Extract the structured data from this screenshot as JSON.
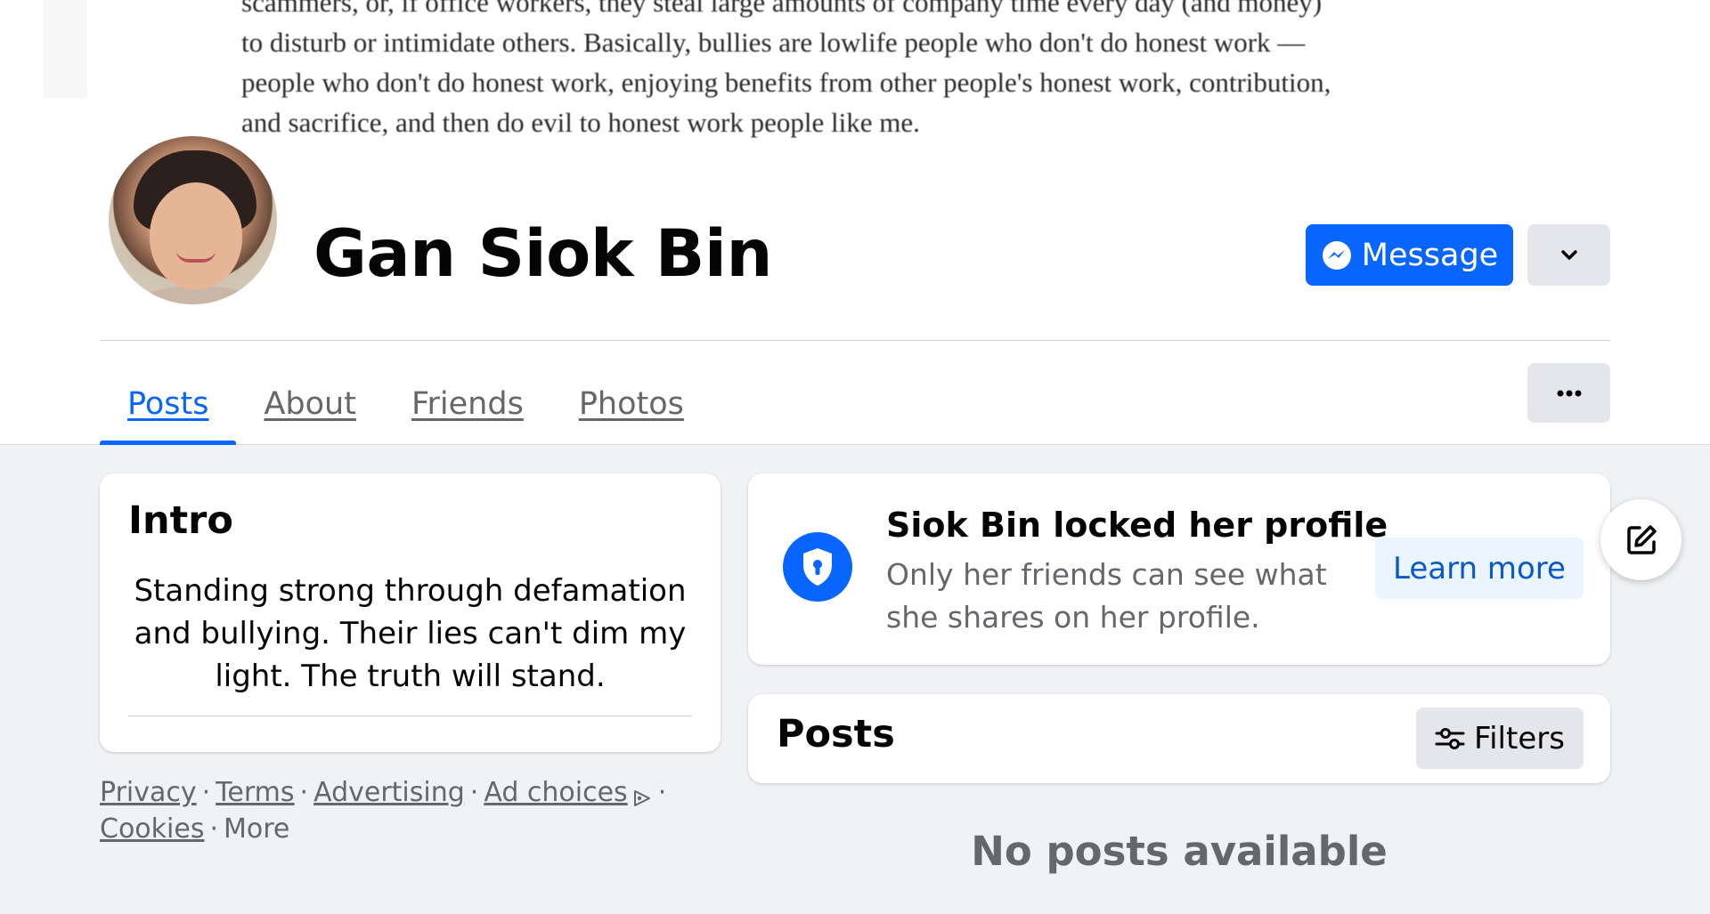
{
  "cover": {
    "lines": [
      "scammers, or, if office workers, they steal large amounts of company time every day (and money)",
      "to disturb or intimidate others. Basically, bullies are lowlife people who don't do honest work —",
      "people who don't do honest work, enjoying benefits from other people's honest work, contribution,",
      "and sacrifice, and then do evil to honest work people like me."
    ]
  },
  "profile": {
    "name": "Gan Siok Bin",
    "message_label": "Message"
  },
  "tabs": [
    {
      "label": "Posts",
      "active": true
    },
    {
      "label": "About",
      "active": false
    },
    {
      "label": "Friends",
      "active": false
    },
    {
      "label": "Photos",
      "active": false
    }
  ],
  "intro": {
    "title": "Intro",
    "bio": "Standing strong through defamation and bullying. Their lies can't dim my light. The truth will stand."
  },
  "footer": {
    "privacy": "Privacy",
    "terms": "Terms",
    "advertising": "Advertising",
    "ad_choices": "Ad choices",
    "cookies": "Cookies",
    "more": "More",
    "separator": "·"
  },
  "locked": {
    "title": "Siok Bin locked her profile",
    "description": "Only her friends can see what she shares on her profile.",
    "learn_more": "Learn more"
  },
  "posts": {
    "title": "Posts",
    "filters_label": "Filters",
    "empty_message": "No posts available"
  },
  "colors": {
    "accent": "#0866ff",
    "page_bg": "#f0f2f5",
    "secondary_text": "#65676b"
  },
  "icons": {
    "message": "messenger-icon",
    "more_actions": "chevron-down-icon",
    "tabs_more": "ellipsis-icon",
    "locked": "shield-keyhole-icon",
    "edit": "edit-compose-icon",
    "filters": "sliders-icon",
    "ad_choices": "adchoices-icon"
  }
}
